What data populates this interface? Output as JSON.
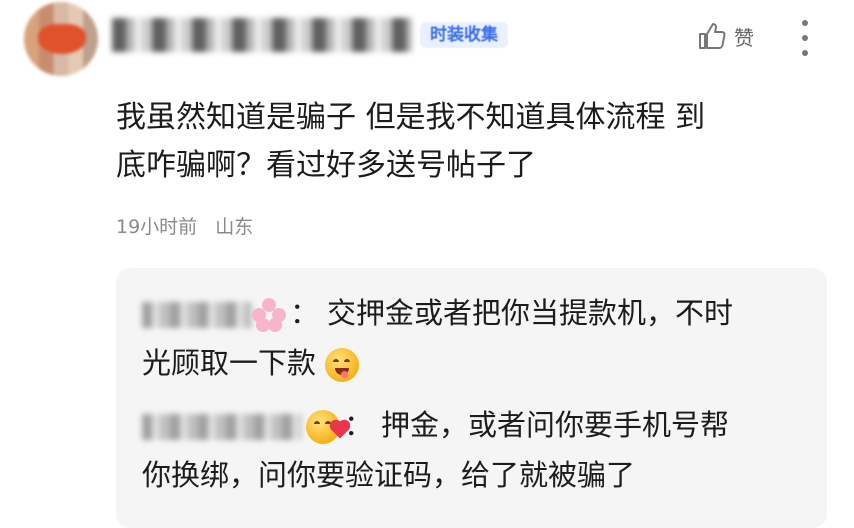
{
  "header": {
    "badge": "时装收集",
    "like_label": "赞"
  },
  "comment": {
    "line1": "我虽然知道是骗子 但是我不知道具体流程 到",
    "line2": "底咋骗啊？看过好多送号帖子了",
    "time": "19小时前",
    "location": "山东"
  },
  "replies": [
    {
      "colon": "：",
      "line1": "交押金或者把你当提款机，不时",
      "line2": "光顾取一下款",
      "emoji": "tongue-wink-emoji"
    },
    {
      "colon": "：",
      "line1": "押金，或者问你要手机号帮",
      "line2": "你换绑，问你要验证码，给了就被骗了",
      "emoji": "kiss-emoji"
    }
  ],
  "icons": {
    "like": "thumbs-up-icon",
    "more": "more-vertical-icon"
  },
  "colors": {
    "badge_text": "#3a6fe8",
    "badge_bg": "#e9f0ff",
    "reply_bg": "#f5f5f5",
    "meta_text": "#8a8a8a"
  }
}
